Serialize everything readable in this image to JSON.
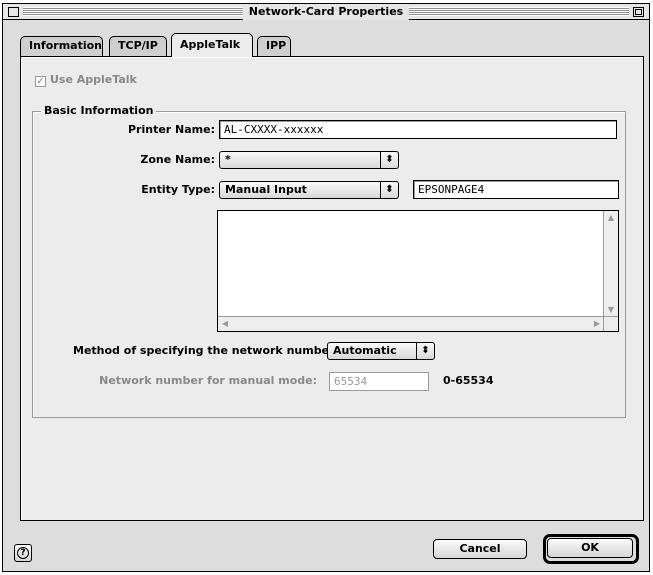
{
  "window": {
    "title": "Network-Card Properties"
  },
  "tabs": [
    {
      "label": "Information",
      "active": false
    },
    {
      "label": "TCP/IP",
      "active": false
    },
    {
      "label": "AppleTalk",
      "active": true
    },
    {
      "label": "IPP",
      "active": false
    }
  ],
  "use_appletalk": {
    "label": "Use AppleTalk",
    "checked": true,
    "enabled": false
  },
  "basic_info": {
    "title": "Basic Information",
    "printer_name_label": "Printer Name:",
    "printer_name_value": "AL-CXXXX-xxxxxx",
    "zone_name_label": "Zone Name:",
    "zone_name_value": "*",
    "entity_type_label": "Entity Type:",
    "entity_type_value": "Manual Input",
    "entity_type_text": "EPSONPAGE4",
    "method_label": "Method of specifying the network number:",
    "method_value": "Automatic",
    "network_number_label": "Network number for manual mode:",
    "network_number_value": "65534",
    "network_number_range": "0-65534"
  },
  "buttons": {
    "help_icon": "question-mark",
    "cancel": "Cancel",
    "ok": "OK"
  }
}
